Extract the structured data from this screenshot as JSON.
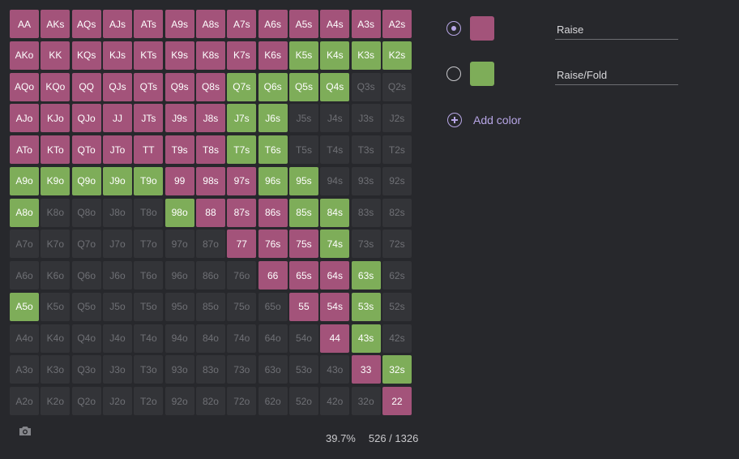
{
  "grid": {
    "rows": [
      [
        [
          "AA",
          "r"
        ],
        [
          "AKs",
          "r"
        ],
        [
          "AQs",
          "r"
        ],
        [
          "AJs",
          "r"
        ],
        [
          "ATs",
          "r"
        ],
        [
          "A9s",
          "r"
        ],
        [
          "A8s",
          "r"
        ],
        [
          "A7s",
          "r"
        ],
        [
          "A6s",
          "r"
        ],
        [
          "A5s",
          "r"
        ],
        [
          "A4s",
          "r"
        ],
        [
          "A3s",
          "r"
        ],
        [
          "A2s",
          "r"
        ]
      ],
      [
        [
          "AKo",
          "r"
        ],
        [
          "KK",
          "r"
        ],
        [
          "KQs",
          "r"
        ],
        [
          "KJs",
          "r"
        ],
        [
          "KTs",
          "r"
        ],
        [
          "K9s",
          "r"
        ],
        [
          "K8s",
          "r"
        ],
        [
          "K7s",
          "r"
        ],
        [
          "K6s",
          "r"
        ],
        [
          "K5s",
          "f"
        ],
        [
          "K4s",
          "f"
        ],
        [
          "K3s",
          "f"
        ],
        [
          "K2s",
          "f"
        ]
      ],
      [
        [
          "AQo",
          "r"
        ],
        [
          "KQo",
          "r"
        ],
        [
          "QQ",
          "r"
        ],
        [
          "QJs",
          "r"
        ],
        [
          "QTs",
          "r"
        ],
        [
          "Q9s",
          "r"
        ],
        [
          "Q8s",
          "r"
        ],
        [
          "Q7s",
          "f"
        ],
        [
          "Q6s",
          "f"
        ],
        [
          "Q5s",
          "f"
        ],
        [
          "Q4s",
          "f"
        ],
        [
          "Q3s",
          "n"
        ],
        [
          "Q2s",
          "n"
        ]
      ],
      [
        [
          "AJo",
          "r"
        ],
        [
          "KJo",
          "r"
        ],
        [
          "QJo",
          "r"
        ],
        [
          "JJ",
          "r"
        ],
        [
          "JTs",
          "r"
        ],
        [
          "J9s",
          "r"
        ],
        [
          "J8s",
          "r"
        ],
        [
          "J7s",
          "f"
        ],
        [
          "J6s",
          "f"
        ],
        [
          "J5s",
          "n"
        ],
        [
          "J4s",
          "n"
        ],
        [
          "J3s",
          "n"
        ],
        [
          "J2s",
          "n"
        ]
      ],
      [
        [
          "ATo",
          "r"
        ],
        [
          "KTo",
          "r"
        ],
        [
          "QTo",
          "r"
        ],
        [
          "JTo",
          "r"
        ],
        [
          "TT",
          "r"
        ],
        [
          "T9s",
          "r"
        ],
        [
          "T8s",
          "r"
        ],
        [
          "T7s",
          "f"
        ],
        [
          "T6s",
          "f"
        ],
        [
          "T5s",
          "n"
        ],
        [
          "T4s",
          "n"
        ],
        [
          "T3s",
          "n"
        ],
        [
          "T2s",
          "n"
        ]
      ],
      [
        [
          "A9o",
          "f"
        ],
        [
          "K9o",
          "f"
        ],
        [
          "Q9o",
          "f"
        ],
        [
          "J9o",
          "f"
        ],
        [
          "T9o",
          "f"
        ],
        [
          "99",
          "r"
        ],
        [
          "98s",
          "r"
        ],
        [
          "97s",
          "r"
        ],
        [
          "96s",
          "f"
        ],
        [
          "95s",
          "f"
        ],
        [
          "94s",
          "n"
        ],
        [
          "93s",
          "n"
        ],
        [
          "92s",
          "n"
        ]
      ],
      [
        [
          "A8o",
          "f"
        ],
        [
          "K8o",
          "n"
        ],
        [
          "Q8o",
          "n"
        ],
        [
          "J8o",
          "n"
        ],
        [
          "T8o",
          "n"
        ],
        [
          "98o",
          "f"
        ],
        [
          "88",
          "r"
        ],
        [
          "87s",
          "r"
        ],
        [
          "86s",
          "r"
        ],
        [
          "85s",
          "f"
        ],
        [
          "84s",
          "f"
        ],
        [
          "83s",
          "n"
        ],
        [
          "82s",
          "n"
        ]
      ],
      [
        [
          "A7o",
          "n"
        ],
        [
          "K7o",
          "n"
        ],
        [
          "Q7o",
          "n"
        ],
        [
          "J7o",
          "n"
        ],
        [
          "T7o",
          "n"
        ],
        [
          "97o",
          "n"
        ],
        [
          "87o",
          "n"
        ],
        [
          "77",
          "r"
        ],
        [
          "76s",
          "r"
        ],
        [
          "75s",
          "r"
        ],
        [
          "74s",
          "f"
        ],
        [
          "73s",
          "n"
        ],
        [
          "72s",
          "n"
        ]
      ],
      [
        [
          "A6o",
          "n"
        ],
        [
          "K6o",
          "n"
        ],
        [
          "Q6o",
          "n"
        ],
        [
          "J6o",
          "n"
        ],
        [
          "T6o",
          "n"
        ],
        [
          "96o",
          "n"
        ],
        [
          "86o",
          "n"
        ],
        [
          "76o",
          "n"
        ],
        [
          "66",
          "r"
        ],
        [
          "65s",
          "r"
        ],
        [
          "64s",
          "r"
        ],
        [
          "63s",
          "f"
        ],
        [
          "62s",
          "n"
        ]
      ],
      [
        [
          "A5o",
          "f"
        ],
        [
          "K5o",
          "n"
        ],
        [
          "Q5o",
          "n"
        ],
        [
          "J5o",
          "n"
        ],
        [
          "T5o",
          "n"
        ],
        [
          "95o",
          "n"
        ],
        [
          "85o",
          "n"
        ],
        [
          "75o",
          "n"
        ],
        [
          "65o",
          "n"
        ],
        [
          "55",
          "r"
        ],
        [
          "54s",
          "r"
        ],
        [
          "53s",
          "f"
        ],
        [
          "52s",
          "n"
        ]
      ],
      [
        [
          "A4o",
          "n"
        ],
        [
          "K4o",
          "n"
        ],
        [
          "Q4o",
          "n"
        ],
        [
          "J4o",
          "n"
        ],
        [
          "T4o",
          "n"
        ],
        [
          "94o",
          "n"
        ],
        [
          "84o",
          "n"
        ],
        [
          "74o",
          "n"
        ],
        [
          "64o",
          "n"
        ],
        [
          "54o",
          "n"
        ],
        [
          "44",
          "r"
        ],
        [
          "43s",
          "f"
        ],
        [
          "42s",
          "n"
        ]
      ],
      [
        [
          "A3o",
          "n"
        ],
        [
          "K3o",
          "n"
        ],
        [
          "Q3o",
          "n"
        ],
        [
          "J3o",
          "n"
        ],
        [
          "T3o",
          "n"
        ],
        [
          "93o",
          "n"
        ],
        [
          "83o",
          "n"
        ],
        [
          "73o",
          "n"
        ],
        [
          "63o",
          "n"
        ],
        [
          "53o",
          "n"
        ],
        [
          "43o",
          "n"
        ],
        [
          "33",
          "r"
        ],
        [
          "32s",
          "f"
        ]
      ],
      [
        [
          "A2o",
          "n"
        ],
        [
          "K2o",
          "n"
        ],
        [
          "Q2o",
          "n"
        ],
        [
          "J2o",
          "n"
        ],
        [
          "T2o",
          "n"
        ],
        [
          "92o",
          "n"
        ],
        [
          "82o",
          "n"
        ],
        [
          "72o",
          "n"
        ],
        [
          "62o",
          "n"
        ],
        [
          "52o",
          "n"
        ],
        [
          "42o",
          "n"
        ],
        [
          "32o",
          "n"
        ],
        [
          "22",
          "r"
        ]
      ]
    ]
  },
  "stats": {
    "percent": "39.7%",
    "combos": "526 / 1326"
  },
  "legend": {
    "items": [
      {
        "name": "Raise",
        "color": "#a3537a",
        "selected": true
      },
      {
        "name": "Raise/Fold",
        "color": "#7ead59",
        "selected": false
      }
    ],
    "add_label": "Add color"
  },
  "icons": {
    "camera": "camera-icon",
    "add": "plus-circle-icon"
  },
  "colors": {
    "background": "#27282c",
    "empty_cell": "#333438",
    "accent": "#b7a6e6"
  }
}
